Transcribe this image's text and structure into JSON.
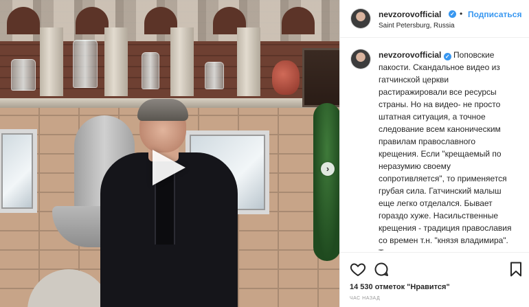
{
  "post": {
    "author": {
      "username": "nevzorovofficial",
      "verified_icon": "verified-badge-icon",
      "location": "Saint Petersburg, Russia"
    },
    "header": {
      "separator": "•",
      "follow_label": "Подписаться"
    },
    "caption": {
      "username": "nevzorovofficial",
      "text": "Поповские пакости. Скандальное видео из гатчинской церкви растиражировали все ресурсы страны. Но на видео- не просто штатная ситуация, а точное следование всем каноническим правилам православного крещения. Если \"крещаемый по неразумию своему сопротивляется\", то применяется грубая сила. Гатчинский малыш еще легко отделался. Бывает гораздо хуже. Насильственные крещения - традиция православия со времен т.н. \"князя владимира\". Тех, кто отказывался - сажали, секли, избивали и убивали. На второй страничке видео я размещу одно из тысяч документальных свидетельств о"
    },
    "actions": {
      "like_icon": "heart-icon",
      "comment_icon": "comment-icon",
      "save_icon": "bookmark-icon"
    },
    "likes_text": "14 530 отметок \"Нравится\"",
    "timestamp": "ЧАС НАЗАД"
  },
  "media": {
    "type": "video",
    "play_icon": "play-icon",
    "next_icon": "chevron-right-icon",
    "next_glyph": "›"
  },
  "colors": {
    "accent": "#3897f0",
    "text": "#262626",
    "muted": "#999999",
    "border": "#efefef"
  }
}
